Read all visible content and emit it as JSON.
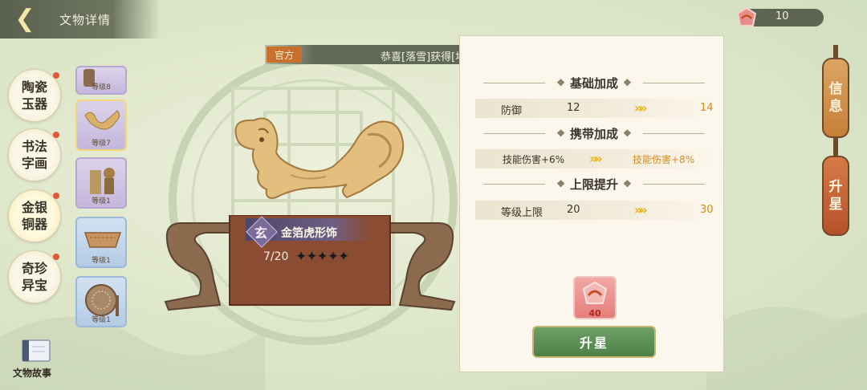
{
  "header": {
    "title": "文物详情",
    "back_icon": "back-chevron-icon"
  },
  "currency": {
    "icon": "badge-icon",
    "count": "10"
  },
  "categories": [
    {
      "label": "陶瓷玉器",
      "has_dot": true
    },
    {
      "label": "书法字画",
      "has_dot": true
    },
    {
      "label": "金银铜器",
      "has_dot": true
    },
    {
      "label": "奇珍异宝",
      "has_dot": true
    }
  ],
  "artifact_list": [
    {
      "level": "等级8",
      "style": "purple"
    },
    {
      "level": "等级7",
      "style": "purple",
      "selected": true
    },
    {
      "level": "等级1",
      "style": "purple"
    },
    {
      "level": "等级1",
      "style": "blue"
    },
    {
      "level": "等级1",
      "style": "blue"
    }
  ],
  "story_label": "文物故事",
  "announcement": {
    "tag": "官方",
    "text": "恭喜[落雪]获得[地级]名士[华佗]"
  },
  "artifact": {
    "rank_char": "玄",
    "name": "金箔虎形饰",
    "progress": "7/20",
    "stars": "✦✦✦✦✦"
  },
  "sections": {
    "base": {
      "title": "基础加成",
      "label": "防御",
      "current": "12",
      "next": "14"
    },
    "carry": {
      "title": "携带加成",
      "current": "技能伤害+6%",
      "next": "技能伤害+8%"
    },
    "limit": {
      "title": "上限提升",
      "label": "等级上限",
      "current": "20",
      "next": "30"
    }
  },
  "cost": {
    "count": "40"
  },
  "upgrade_button": "升星",
  "side_tabs": [
    {
      "label": "信息"
    },
    {
      "label": "升星"
    }
  ],
  "colors": {
    "accent_orange": "#d98a1f",
    "button_green": "#4d8148",
    "header": "#606958"
  }
}
